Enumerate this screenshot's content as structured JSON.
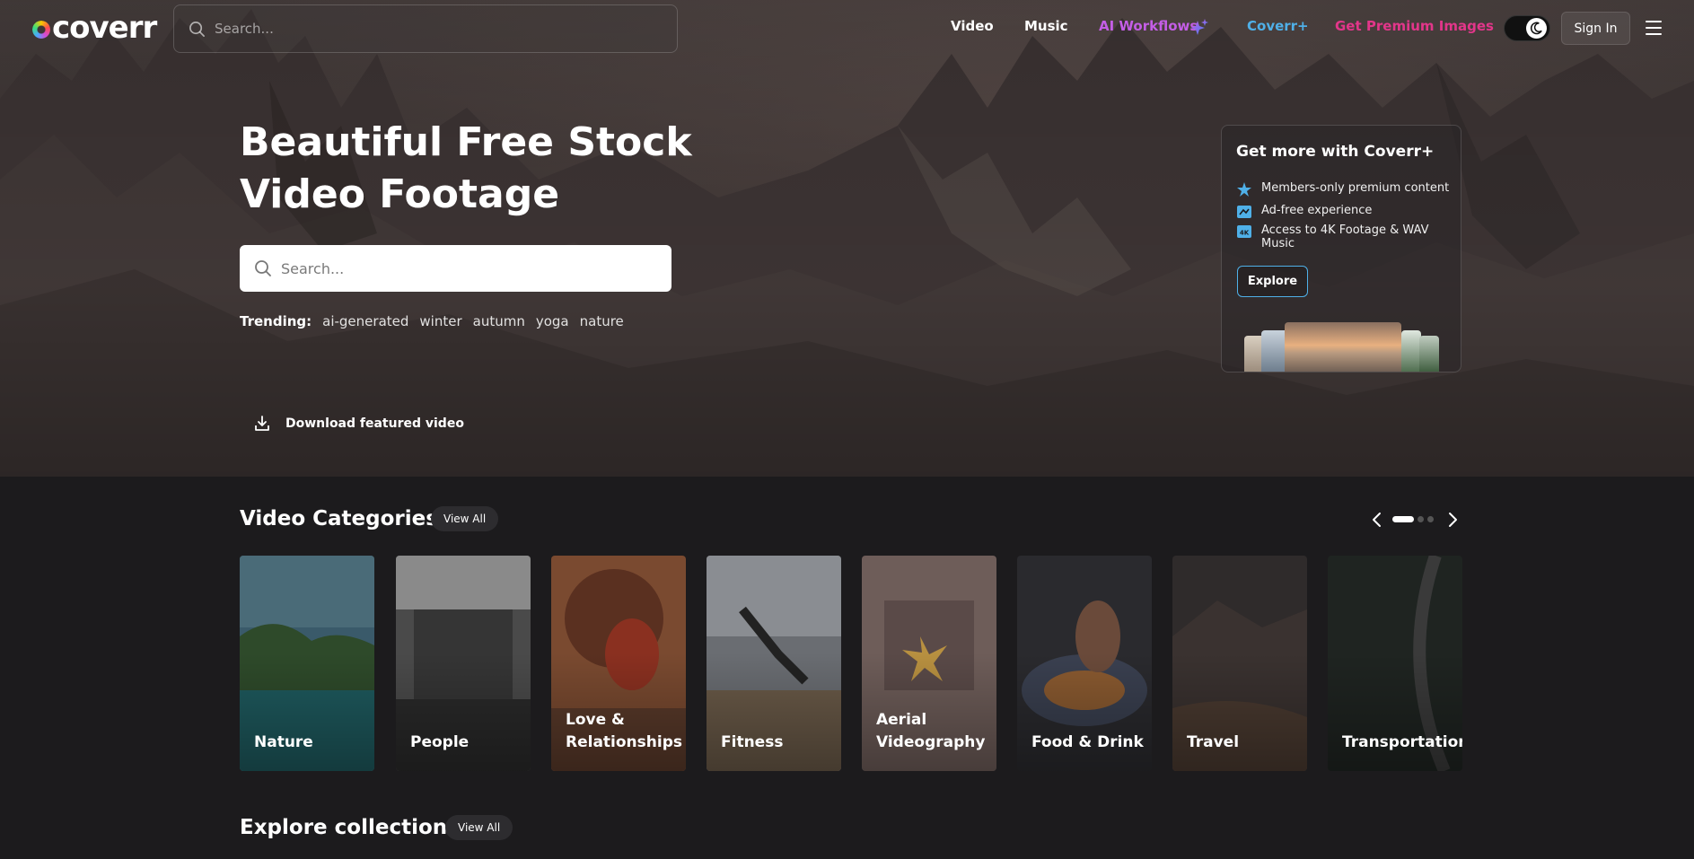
{
  "brand": {
    "logo_text": "coverr"
  },
  "nav": {
    "search_placeholder": "Search...",
    "links": [
      "Video",
      "Music",
      "AI Workflows",
      "Coverr+",
      "Get Premium Images"
    ],
    "signin_label": "Sign In"
  },
  "hero": {
    "title_line1": "Beautiful Free Stock",
    "title_line2": "Video Footage",
    "search_placeholder": "Search...",
    "trending_label": "Trending:",
    "trending": [
      "ai-generated",
      "winter",
      "autumn",
      "yoga",
      "nature"
    ],
    "download_label": "Download featured video"
  },
  "promo": {
    "title": "Get more with Coverr+",
    "items": [
      "Members-only premium content",
      "Ad-free experience",
      "Access to 4K Footage & WAV Music"
    ],
    "explore_label": "Explore"
  },
  "categories": {
    "title": "Video Categories",
    "view_all_label": "View All",
    "carousel": {
      "pages": 3,
      "current": 1
    },
    "items": [
      {
        "label": "Nature",
        "colors": [
          "#2d4a3a",
          "#1f6a6a"
        ]
      },
      {
        "label": "People",
        "colors": [
          "#555555",
          "#2a2a2a"
        ]
      },
      {
        "label": "Love & Relationships",
        "colors": [
          "#6a3a28",
          "#8a4a30"
        ]
      },
      {
        "label": "Fitness",
        "colors": [
          "#5a5d62",
          "#3a3c40"
        ]
      },
      {
        "label": "Aerial Videography",
        "colors": [
          "#6b5a56",
          "#4a3e3c"
        ]
      },
      {
        "label": "Food & Drink",
        "colors": [
          "#2a2a2e",
          "#4a3a30"
        ]
      },
      {
        "label": "Travel",
        "colors": [
          "#2f2b2b",
          "#3d3432"
        ]
      },
      {
        "label": "Transportation",
        "colors": [
          "#1f2421",
          "#2c2c2c"
        ]
      }
    ]
  },
  "collections": {
    "title": "Explore collections",
    "view_all_label": "View All"
  }
}
